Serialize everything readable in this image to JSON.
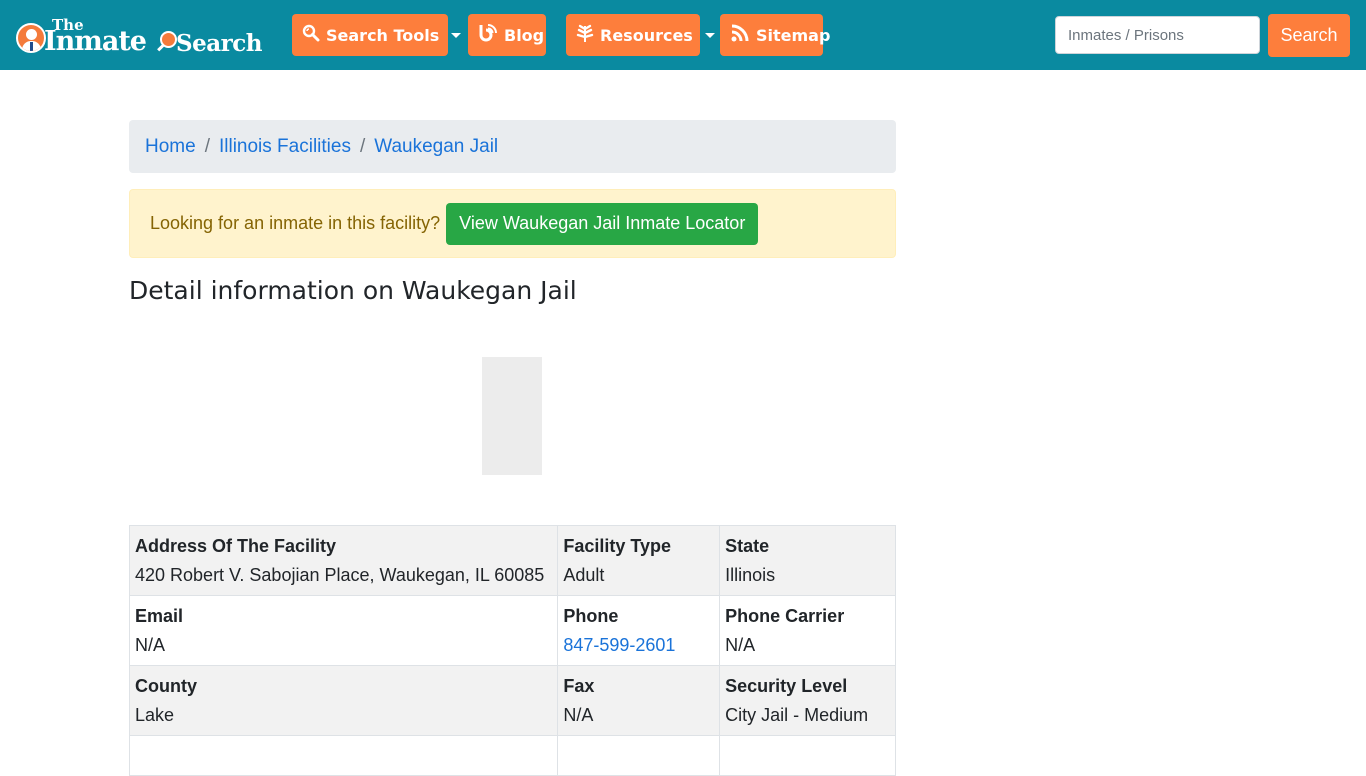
{
  "navbar": {
    "logo": {
      "line1": "The",
      "line2": "Inmate",
      "line3": "Search"
    },
    "buttons": [
      {
        "label": "Search Tools",
        "icon": "search-icon",
        "has_dropdown": true
      },
      {
        "label": "Blog",
        "icon": "blog-icon",
        "has_dropdown": false
      },
      {
        "label": "Resources",
        "icon": "leaf-icon",
        "has_dropdown": true
      },
      {
        "label": "Sitemap",
        "icon": "rss-icon",
        "has_dropdown": false
      }
    ],
    "search": {
      "placeholder": "Inmates / Prisons",
      "value": "",
      "button_label": "Search"
    }
  },
  "breadcrumb": {
    "items": [
      "Home",
      "Illinois Facilities",
      "Waukegan Jail"
    ],
    "separator": "/"
  },
  "alert": {
    "text": "Looking for an inmate in this facility?",
    "button_label": "View Waukegan Jail Inmate Locator"
  },
  "page_title": "Detail information on Waukegan Jail",
  "table": {
    "rows": [
      [
        {
          "label": "Address Of The Facility",
          "value": "420 Robert V. Sabojian Place, Waukegan, IL 60085"
        },
        {
          "label": "Facility Type",
          "value": "Adult"
        },
        {
          "label": "State",
          "value": "Illinois"
        }
      ],
      [
        {
          "label": "Email",
          "value": "N/A"
        },
        {
          "label": "Phone",
          "value": "847-599-2601",
          "link": true
        },
        {
          "label": "Phone Carrier",
          "value": "N/A"
        }
      ],
      [
        {
          "label": "County",
          "value": "Lake"
        },
        {
          "label": "Fax",
          "value": "N/A"
        },
        {
          "label": "Security Level",
          "value": "City Jail - Medium"
        }
      ]
    ]
  },
  "colors": {
    "navbar": "#0a8aa0",
    "accent_orange": "#fd7e3c",
    "success_green": "#28a745",
    "link_blue": "#1a73d9",
    "alert_bg": "#fff3cd"
  }
}
